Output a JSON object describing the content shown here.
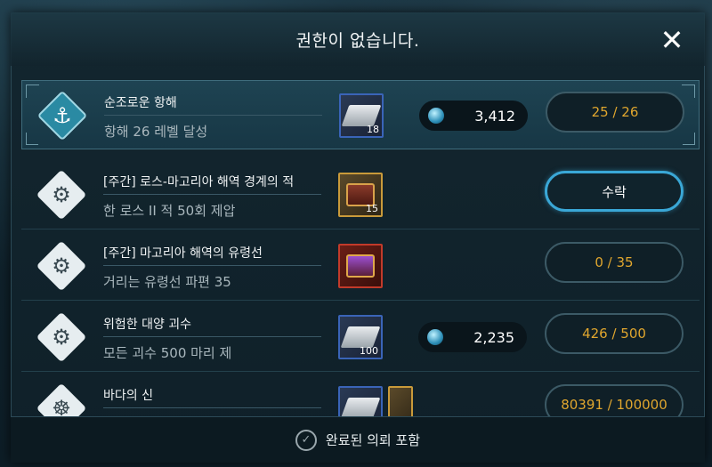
{
  "dialog": {
    "title": "권한이 없습니다.",
    "close_icon": "close-icon"
  },
  "quests": [
    {
      "name": "순조로운 항해",
      "desc": "항해 26 레벨 달성",
      "icon": "anchor-icon",
      "selected": true,
      "rewards": [
        {
          "icon": "metal-plate-icon",
          "count": "18",
          "frame": "blue"
        }
      ],
      "gems": "3,412",
      "progress": "25 / 26"
    },
    {
      "name": "[주간] 로스-마고리아 해역 경계의 적",
      "desc": "한 로스 II 적 50회 제압",
      "icon": "cannon-icon",
      "rewards": [
        {
          "icon": "treasure-chest-icon",
          "count": "15",
          "frame": "gold"
        }
      ],
      "action": "수락"
    },
    {
      "name": "[주간] 마고리아 해역의 유령선",
      "desc": "거리는 유령선 파편 35",
      "icon": "cannon-icon",
      "rewards": [
        {
          "icon": "magic-chest-icon",
          "count": "",
          "frame": "red"
        }
      ],
      "progress": "0 / 35"
    },
    {
      "name": "위험한 대양 괴수",
      "desc": "모든 괴수 500 마리 제",
      "icon": "cannon-icon",
      "rewards": [
        {
          "icon": "metal-plate-icon",
          "count": "100",
          "frame": "blue"
        }
      ],
      "gems": "2,235",
      "progress": "426 / 500"
    },
    {
      "name": "바다의 신",
      "desc": "",
      "icon": "ship-wheel-icon",
      "rewards": [
        {
          "icon": "metal-plate-icon",
          "count": "",
          "frame": "blue"
        }
      ],
      "progress": "80391 / 100000"
    }
  ],
  "footer": {
    "checkbox_icon": "check-circle-icon",
    "label": "완료된 의뢰 포함"
  },
  "colors": {
    "progress_text": "#e0a62e",
    "accept_border": "#3aa7d6",
    "gem": "#2d8fb8"
  }
}
